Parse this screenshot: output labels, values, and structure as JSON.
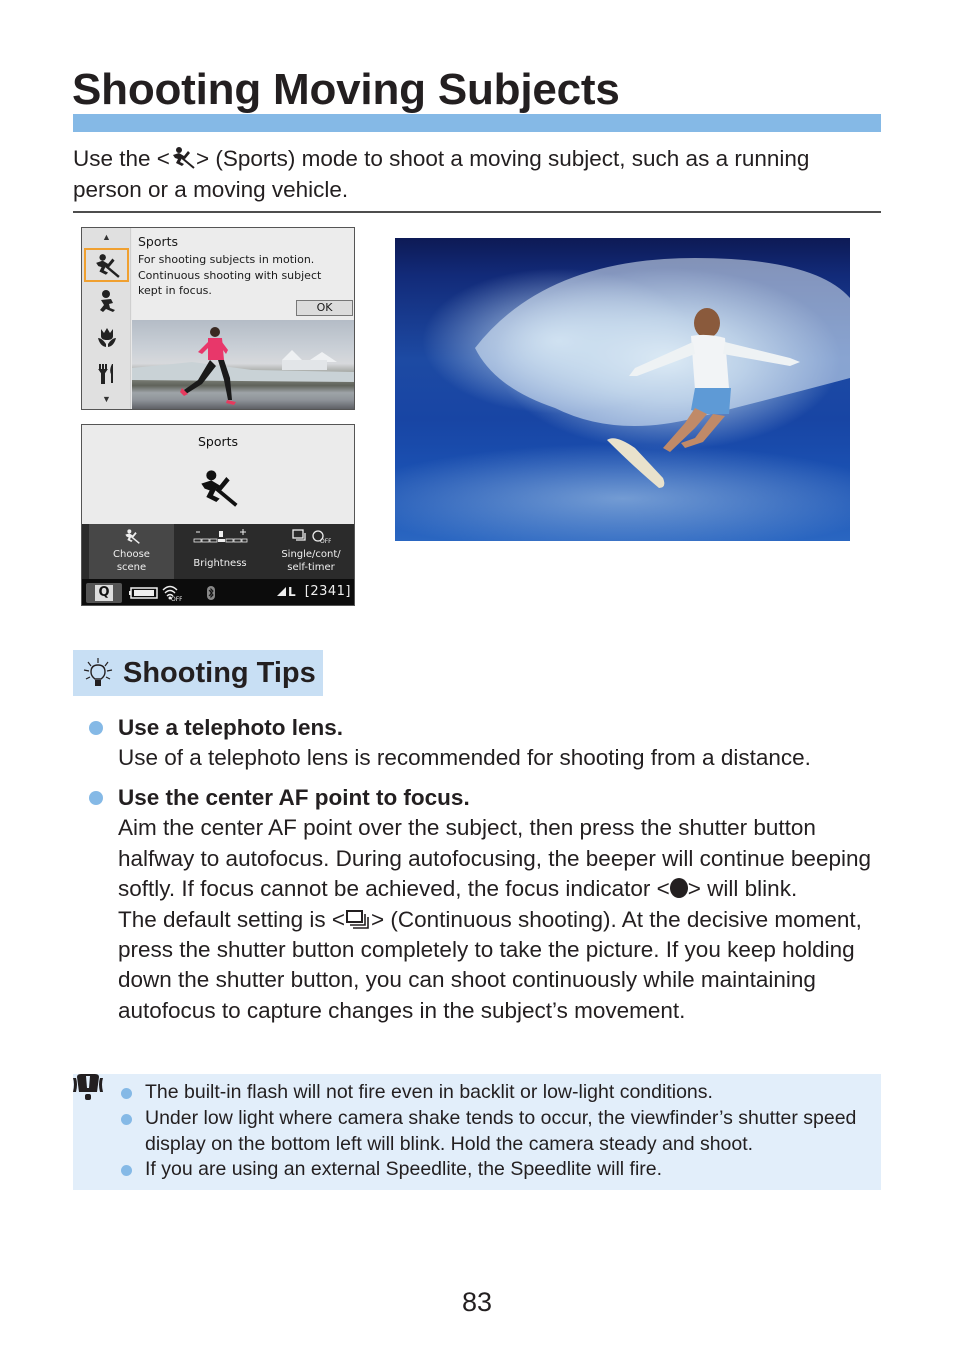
{
  "page": {
    "title": "Shooting Moving Subjects",
    "intro_before_icon": "Use the <",
    "intro_icon": "sports-mode-icon",
    "intro_after_icon": "> (Sports) mode to shoot a moving subject, such as a running person or a moving vehicle.",
    "accent_color": "#85b9e6",
    "page_number": "83"
  },
  "camera_screen_1": {
    "scene_list": [
      {
        "icon": "arrow-up-icon"
      },
      {
        "icon": "sports-mode-icon",
        "selected": true
      },
      {
        "icon": "kids-mode-icon"
      },
      {
        "icon": "close-up-icon"
      },
      {
        "icon": "food-mode-icon"
      },
      {
        "icon": "arrow-down-icon"
      }
    ],
    "heading": "Sports",
    "description": "For shooting subjects in motion. Continuous shooting with subject kept in focus.",
    "ok_label": "OK",
    "selection_color": "#f0a030"
  },
  "camera_screen_2": {
    "heading": "Sports",
    "quick_controls": [
      {
        "label": "Choose scene",
        "icon": "sports-mode-icon",
        "selected": true
      },
      {
        "label": "Brightness",
        "icon": "brightness-scale-icon"
      },
      {
        "label": "Single/cont/ self-timer",
        "icon": "drive-mode-icon"
      }
    ],
    "status_bar": {
      "q_label": "Q",
      "battery": "battery-full-icon",
      "wifi": "wifi-off-icon",
      "bluetooth": "bluetooth-icon",
      "quality": "L",
      "shots_remaining": "[2341]"
    }
  },
  "photo": {
    "subject": "surfer riding a wave"
  },
  "shooting_tips": {
    "heading": "Shooting Tips",
    "items": [
      {
        "title": "Use a telephoto lens.",
        "body": "Use of a telephoto lens is recommended for shooting from a distance."
      },
      {
        "title": "Use the center AF point to focus.",
        "body_1": "Aim the center AF point over the subject, then press the shutter button halfway to autofocus. During autofocusing, the beeper will continue beeping softly. If focus cannot be achieved, the focus indicator <",
        "body_1_icon": "focus-indicator-icon",
        "body_1_end": "> will blink.",
        "body_2": "The default setting is <",
        "body_2_icon": "continuous-shooting-icon",
        "body_2_end": "> (Continuous shooting). At the decisive moment, press the shutter button completely to take the picture. If you keep holding down the shutter button, you can shoot continuously while maintaining autofocus to capture changes in the subject’s movement."
      }
    ]
  },
  "caution": {
    "icon": "caution-icon",
    "items": [
      "The built-in flash will not fire even in backlit or low-light conditions.",
      "Under low light where camera shake tends to occur, the viewfinder’s shutter speed display on the bottom left will blink. Hold the camera steady and shoot.",
      "If you are using an external Speedlite, the Speedlite will fire."
    ]
  }
}
